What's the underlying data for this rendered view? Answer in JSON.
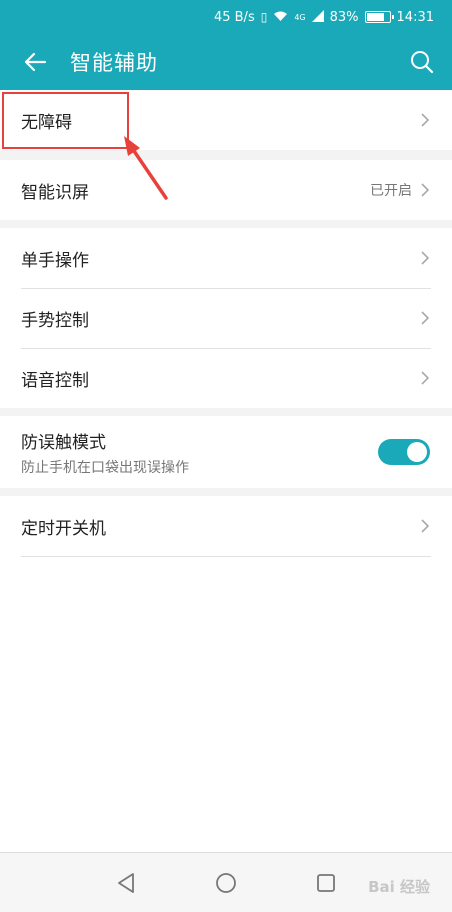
{
  "status": {
    "speed": "45 B/s",
    "network": "4G",
    "battery": "83%",
    "battery_level": 0.83,
    "time": "14:31"
  },
  "header": {
    "title": "智能辅助"
  },
  "groups": [
    {
      "items": [
        {
          "label": "无障碍"
        }
      ]
    },
    {
      "items": [
        {
          "label": "智能识屏",
          "value": "已开启"
        }
      ]
    },
    {
      "items": [
        {
          "label": "单手操作"
        },
        {
          "label": "手势控制"
        },
        {
          "label": "语音控制"
        }
      ]
    },
    {
      "items": [
        {
          "label": "防误触模式",
          "sub": "防止手机在口袋出现误操作",
          "toggle": true
        }
      ]
    },
    {
      "items": [
        {
          "label": "定时开关机"
        }
      ]
    }
  ],
  "annotation": {
    "color": "#e8413c"
  },
  "watermark": {
    "text": "Bai 经验"
  },
  "colors": {
    "accent": "#1aa9b8",
    "highlight": "#e8413c"
  }
}
